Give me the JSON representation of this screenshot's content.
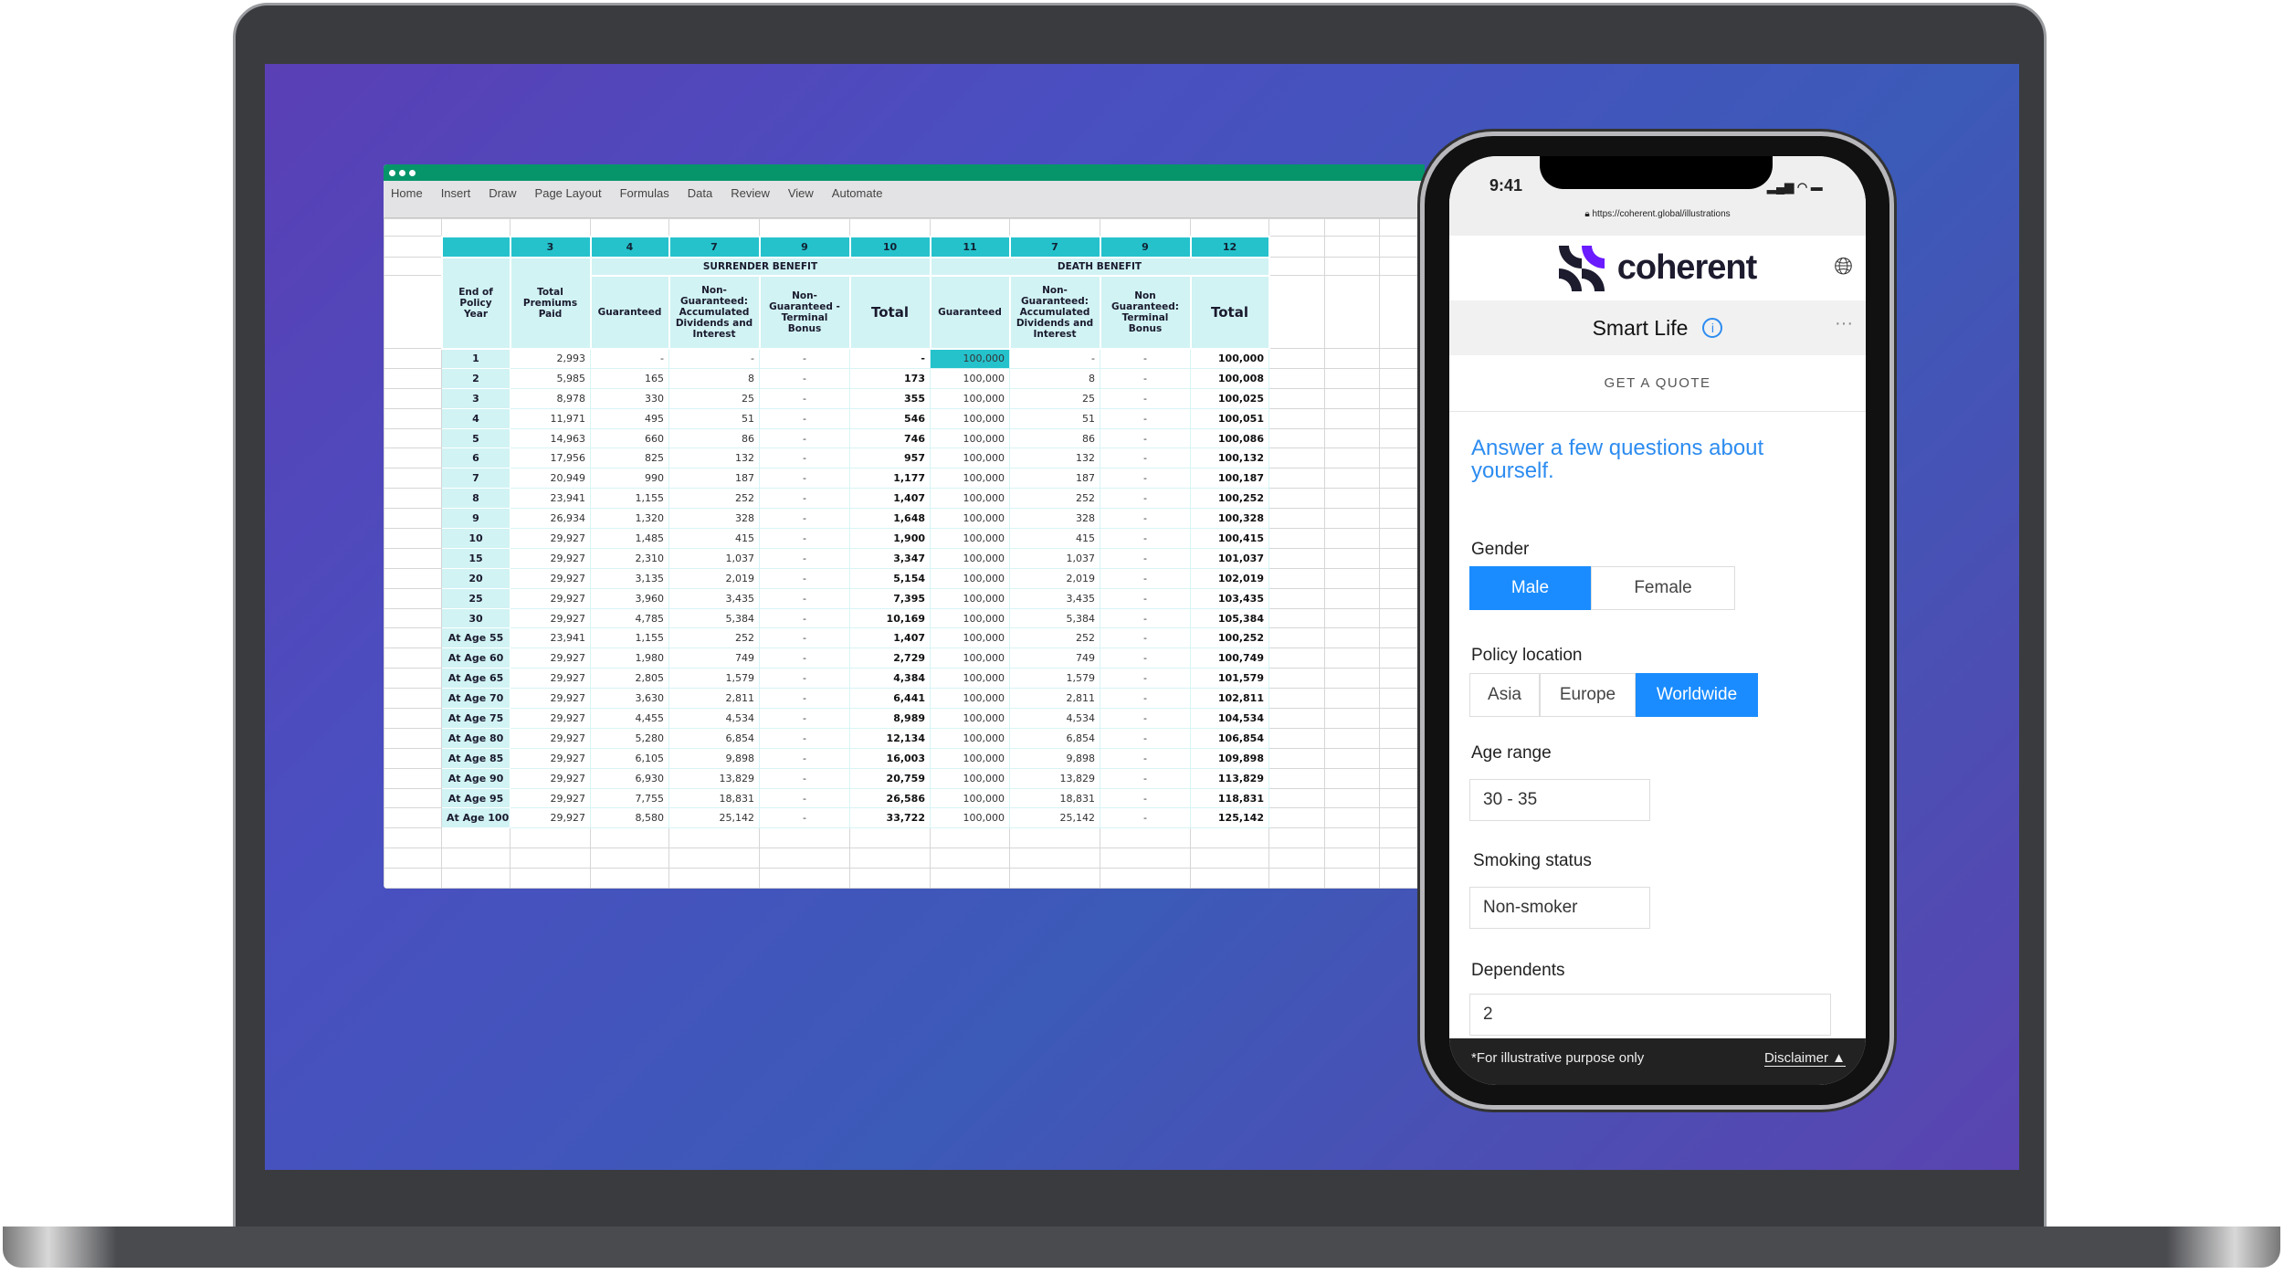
{
  "spreadsheet": {
    "menu": [
      "Home",
      "Insert",
      "Draw",
      "Page Layout",
      "Formulas",
      "Data",
      "Review",
      "View",
      "Automate"
    ],
    "column_numbers": [
      "",
      "3",
      "4",
      "7",
      "9",
      "10",
      "11",
      "7",
      "9",
      "12"
    ],
    "sections": {
      "surrender": "SURRENDER BENEFIT",
      "death": "DEATH BENEFIT"
    },
    "headers": [
      "End of Policy Year",
      "Total Premiums Paid",
      "Guaranteed",
      "Non-Guaranteed: Accumulated Dividends and Interest",
      "Non-Guaranteed - Terminal Bonus",
      "Total",
      "Guaranteed",
      "Non-Guaranteed: Accumulated Dividends and Interest",
      "Non Guaranteed: Terminal Bonus",
      "Total"
    ],
    "rows": [
      [
        "1",
        "2,993",
        "-",
        "-",
        "-",
        "-",
        "100,000",
        "-",
        "-",
        "100,000"
      ],
      [
        "2",
        "5,985",
        "165",
        "8",
        "-",
        "173",
        "100,000",
        "8",
        "-",
        "100,008"
      ],
      [
        "3",
        "8,978",
        "330",
        "25",
        "-",
        "355",
        "100,000",
        "25",
        "-",
        "100,025"
      ],
      [
        "4",
        "11,971",
        "495",
        "51",
        "-",
        "546",
        "100,000",
        "51",
        "-",
        "100,051"
      ],
      [
        "5",
        "14,963",
        "660",
        "86",
        "-",
        "746",
        "100,000",
        "86",
        "-",
        "100,086"
      ],
      [
        "6",
        "17,956",
        "825",
        "132",
        "-",
        "957",
        "100,000",
        "132",
        "-",
        "100,132"
      ],
      [
        "7",
        "20,949",
        "990",
        "187",
        "-",
        "1,177",
        "100,000",
        "187",
        "-",
        "100,187"
      ],
      [
        "8",
        "23,941",
        "1,155",
        "252",
        "-",
        "1,407",
        "100,000",
        "252",
        "-",
        "100,252"
      ],
      [
        "9",
        "26,934",
        "1,320",
        "328",
        "-",
        "1,648",
        "100,000",
        "328",
        "-",
        "100,328"
      ],
      [
        "10",
        "29,927",
        "1,485",
        "415",
        "-",
        "1,900",
        "100,000",
        "415",
        "-",
        "100,415"
      ],
      [
        "15",
        "29,927",
        "2,310",
        "1,037",
        "-",
        "3,347",
        "100,000",
        "1,037",
        "-",
        "101,037"
      ],
      [
        "20",
        "29,927",
        "3,135",
        "2,019",
        "-",
        "5,154",
        "100,000",
        "2,019",
        "-",
        "102,019"
      ],
      [
        "25",
        "29,927",
        "3,960",
        "3,435",
        "-",
        "7,395",
        "100,000",
        "3,435",
        "-",
        "103,435"
      ],
      [
        "30",
        "29,927",
        "4,785",
        "5,384",
        "-",
        "10,169",
        "100,000",
        "5,384",
        "-",
        "105,384"
      ],
      [
        "At Age 55",
        "23,941",
        "1,155",
        "252",
        "-",
        "1,407",
        "100,000",
        "252",
        "-",
        "100,252"
      ],
      [
        "At Age 60",
        "29,927",
        "1,980",
        "749",
        "-",
        "2,729",
        "100,000",
        "749",
        "-",
        "100,749"
      ],
      [
        "At Age 65",
        "29,927",
        "2,805",
        "1,579",
        "-",
        "4,384",
        "100,000",
        "1,579",
        "-",
        "101,579"
      ],
      [
        "At Age 70",
        "29,927",
        "3,630",
        "2,811",
        "-",
        "6,441",
        "100,000",
        "2,811",
        "-",
        "102,811"
      ],
      [
        "At Age 75",
        "29,927",
        "4,455",
        "4,534",
        "-",
        "8,989",
        "100,000",
        "4,534",
        "-",
        "104,534"
      ],
      [
        "At Age 80",
        "29,927",
        "5,280",
        "6,854",
        "-",
        "12,134",
        "100,000",
        "6,854",
        "-",
        "106,854"
      ],
      [
        "At Age 85",
        "29,927",
        "6,105",
        "9,898",
        "-",
        "16,003",
        "100,000",
        "9,898",
        "-",
        "109,898"
      ],
      [
        "At Age 90",
        "29,927",
        "6,930",
        "13,829",
        "-",
        "20,759",
        "100,000",
        "13,829",
        "-",
        "113,829"
      ],
      [
        "At Age 95",
        "29,927",
        "7,755",
        "18,831",
        "-",
        "26,586",
        "100,000",
        "18,831",
        "-",
        "118,831"
      ],
      [
        "At Age 100",
        "29,927",
        "8,580",
        "25,142",
        "-",
        "33,722",
        "100,000",
        "25,142",
        "-",
        "125,142"
      ]
    ]
  },
  "phone": {
    "time": "9:41",
    "url": "https://coherent.global/illustrations",
    "brand": "coherent",
    "product": "Smart Life",
    "tab": "GET A QUOTE",
    "intro": "Answer a few questions about yourself.",
    "gender": {
      "label": "Gender",
      "options": [
        "Male",
        "Female"
      ],
      "selected": "Male"
    },
    "location": {
      "label": "Policy location",
      "options": [
        "Asia",
        "Europe",
        "Worldwide"
      ],
      "selected": "Worldwide"
    },
    "age": {
      "label": "Age range",
      "value": "30 - 35"
    },
    "smoking": {
      "label": "Smoking status",
      "value": "Non-smoker"
    },
    "dependents": {
      "label": "Dependents",
      "value": "2"
    },
    "footer_note": "*For illustrative purpose only",
    "disclaimer": "Disclaimer",
    "accent": "#1a8cff",
    "brand_purple": "#6a1bff"
  }
}
